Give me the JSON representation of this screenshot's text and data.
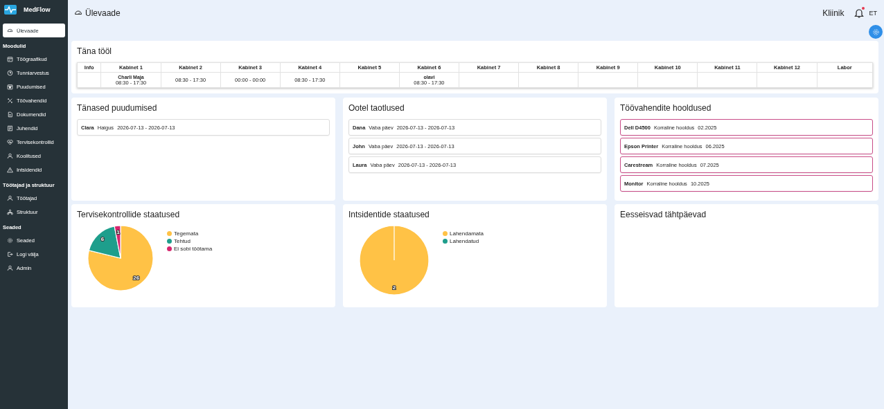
{
  "sidebar": {
    "app_name": "MedFlow",
    "top_item": {
      "label": "Ülevaade",
      "selected": true
    },
    "sections": [
      {
        "title": "Moodulid",
        "items": [
          {
            "label": "Töögraafikud",
            "selected": false
          },
          {
            "label": "Tunniarvestus",
            "selected": false
          },
          {
            "label": "Puudumised",
            "selected": false
          },
          {
            "label": "Töövahendid",
            "selected": false
          },
          {
            "label": "Dokumendid",
            "selected": false
          },
          {
            "label": "Juhendid",
            "selected": false
          },
          {
            "label": "Tervisekontrollid",
            "selected": false
          },
          {
            "label": "Koolitused",
            "selected": false
          },
          {
            "label": "Intsidendid",
            "selected": false
          }
        ]
      },
      {
        "title": "Töötajad ja struktuur",
        "items": [
          {
            "label": "Töötajad",
            "selected": false
          },
          {
            "label": "Struktuur",
            "selected": false
          }
        ]
      },
      {
        "title": "Seaded",
        "items": [
          {
            "label": "Seaded",
            "selected": false
          },
          {
            "label": "Logi välja",
            "selected": false
          },
          {
            "label": "Admin",
            "selected": false
          }
        ]
      }
    ]
  },
  "header": {
    "title": "Ülevaade",
    "clinic": "Kliinik",
    "notification": true,
    "language": "ET"
  },
  "today": {
    "title": "Täna tööl",
    "columns": [
      "Info",
      "Kabinet 1",
      "Kabinet 2",
      "Kabinet 3",
      "Kabinet 4",
      "Kabinet 5",
      "Kabinet 6",
      "Kabinet 7",
      "Kabinet 8",
      "Kabinet 9",
      "Kabinet 10",
      "Kabinet 11",
      "Kabinet 12",
      "Labor"
    ],
    "cells": [
      {},
      {
        "name": "Charli Maja",
        "time": "08:30 - 17:30"
      },
      {
        "time": "08:30 - 17:30"
      },
      {
        "time": "00:00 - 00:00"
      },
      {
        "time": "08:30 - 17:30"
      },
      {},
      {
        "name": "olavi",
        "time": "08:30 - 17:30"
      },
      {},
      {},
      {},
      {},
      {},
      {},
      {}
    ]
  },
  "absences": {
    "title": "Tänased puudumised",
    "items": [
      {
        "name": "Clara",
        "type": "Haigus",
        "dates": "2026-07-13 - 2026-07-13"
      }
    ]
  },
  "pending": {
    "title": "Ootel taotlused",
    "items": [
      {
        "name": "Dana",
        "type": "Vaba päev",
        "dates": "2026-07-13 - 2026-07-13"
      },
      {
        "name": "John",
        "type": "Vaba päev",
        "dates": "2026-07-13 - 2026-07-13"
      },
      {
        "name": "Laura",
        "type": "Vaba päev",
        "dates": "2026-07-13 - 2026-07-13"
      }
    ]
  },
  "maintenance": {
    "title": "Töövahendite hooldused",
    "items": [
      {
        "name": "Dell D4500",
        "type": "Korraline hooldus",
        "date": "02.2025"
      },
      {
        "name": "Epson Printer",
        "type": "Korraline hooldus",
        "date": "06.2025"
      },
      {
        "name": "Carestream",
        "type": "Korraline hooldus",
        "date": "07.2025"
      },
      {
        "name": "Monitor",
        "type": "Korraline hooldus",
        "date": "10.2025"
      }
    ]
  },
  "health": {
    "title": "Tervisekontrollide staatused",
    "chart_data": {
      "type": "pie",
      "categories": [
        "Tegemata",
        "Tehtud",
        "Ei sobi töötama"
      ],
      "values": [
        26,
        6,
        1
      ],
      "data_labels": true,
      "legend": "right"
    }
  },
  "incidents": {
    "title": "Intsidentide staatused",
    "chart_data": {
      "type": "pie",
      "categories": [
        "Lahendamata",
        "Lahendatud"
      ],
      "values": [
        2,
        0
      ],
      "data_labels": true,
      "legend": "right"
    }
  },
  "birthdays": {
    "title": "Eesseisvad tähtpäevad"
  }
}
